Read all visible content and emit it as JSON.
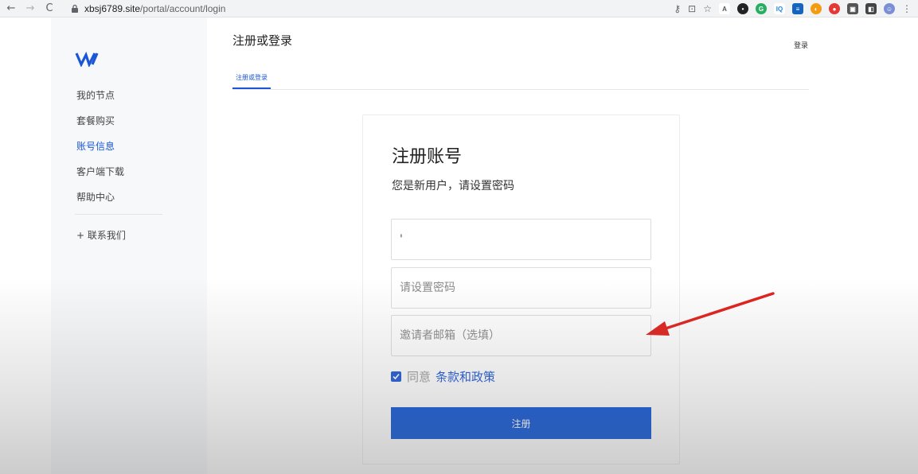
{
  "browser": {
    "url_host": "xbsj6789.site",
    "url_path": "/portal/account/login",
    "ext_colors": [
      "#e91e63",
      "#222222",
      "#27ae60",
      "#1e88e5",
      "#1565c0",
      "#f39c12",
      "#e53935",
      "#555555",
      "#444444",
      "#7b8fd6"
    ]
  },
  "sidebar": {
    "logo_text": "W",
    "items": [
      {
        "label": "我的节点"
      },
      {
        "label": "套餐购买"
      },
      {
        "label": "账号信息"
      },
      {
        "label": "客户端下载"
      },
      {
        "label": "帮助中心"
      }
    ],
    "contact_label": "+ 联系我们"
  },
  "header": {
    "title": "注册或登录",
    "login_link": "登录",
    "tab_label": "注册或登录"
  },
  "form": {
    "title": "注册账号",
    "subtitle": "您是新用户，请设置密码",
    "account_value": "'",
    "password_placeholder": "请设置密码",
    "invite_placeholder": "邀请者邮箱（选填）",
    "agree_text": "同意",
    "terms_link": "条款和政策",
    "submit_label": "注册"
  },
  "colors": {
    "accent": "#1a56d6",
    "button": "#0b53d6",
    "annotation_arrow": "#e0201c"
  }
}
